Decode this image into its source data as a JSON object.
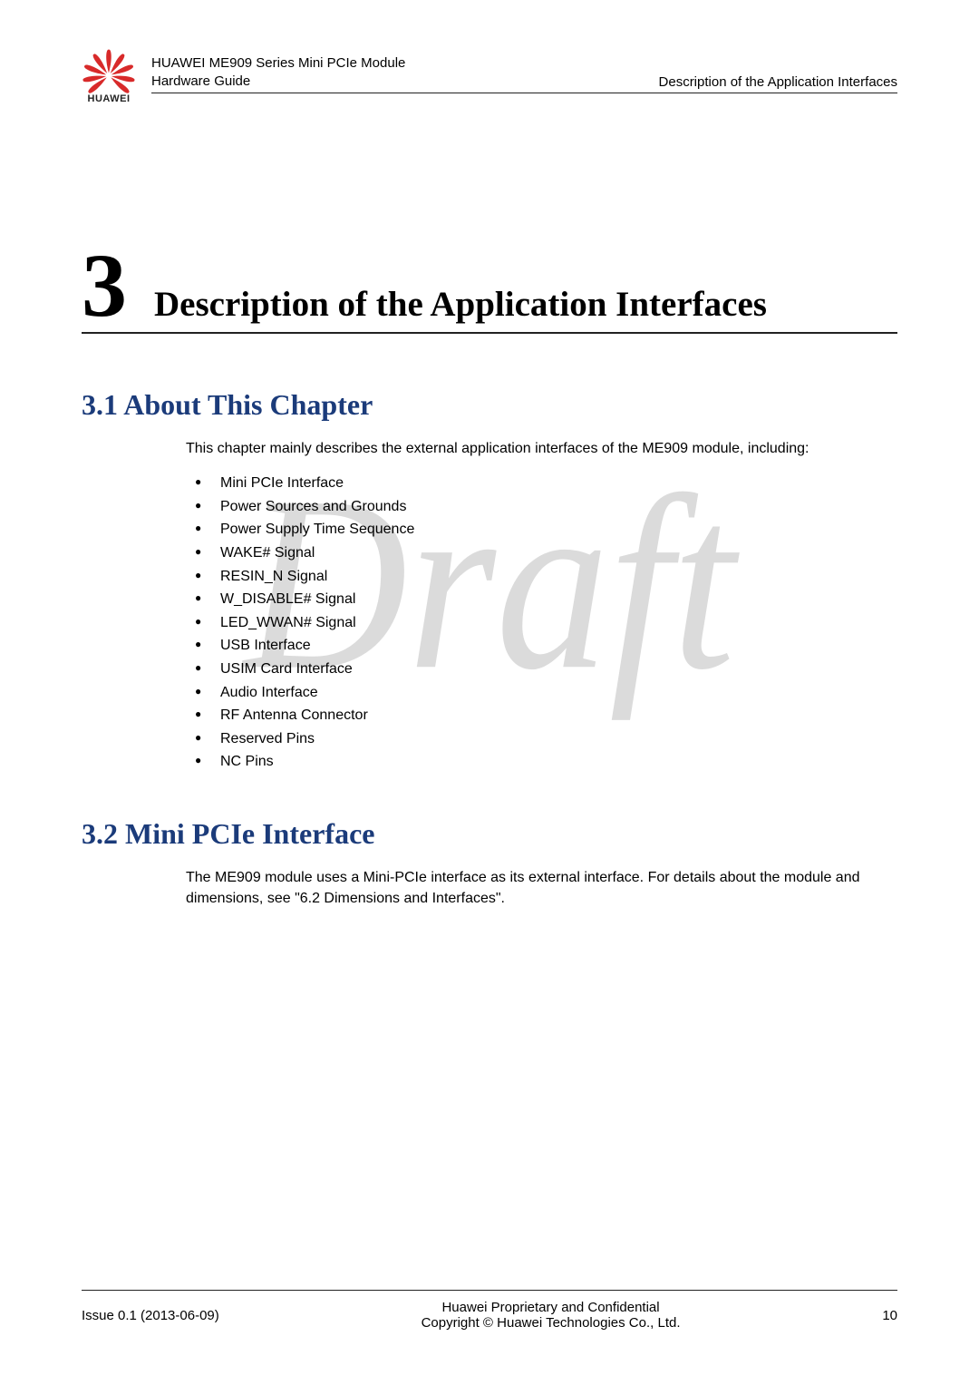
{
  "header": {
    "logo_text": "HUAWEI",
    "doc_title_line1": "HUAWEI ME909 Series Mini PCIe Module",
    "doc_title_line2": "Hardware Guide",
    "chapter_ref": "Description of the Application Interfaces"
  },
  "chapter": {
    "number": "3",
    "title": "Description of the Application Interfaces"
  },
  "section1": {
    "heading": "3.1 About This Chapter",
    "intro": "This chapter mainly describes the external application interfaces of the ME909 module, including:",
    "items": [
      "Mini PCIe Interface",
      "Power Sources and Grounds",
      "Power Supply Time Sequence",
      "WAKE# Signal",
      "RESIN_N Signal",
      "W_DISABLE# Signal",
      "LED_WWAN# Signal",
      "USB Interface",
      "USIM Card Interface",
      "Audio Interface",
      "RF Antenna Connector",
      "Reserved Pins",
      "NC Pins"
    ]
  },
  "section2": {
    "heading": "3.2 Mini PCIe Interface",
    "body": "The ME909 module uses a Mini-PCIe interface as its external interface. For details about the module and dimensions, see \"6.2 Dimensions and Interfaces\"."
  },
  "watermark": "Draft",
  "footer": {
    "issue": "Issue 0.1 (2013-06-09)",
    "center_line1": "Huawei Proprietary and Confidential",
    "center_line2": "Copyright © Huawei Technologies Co., Ltd.",
    "page_number": "10"
  }
}
